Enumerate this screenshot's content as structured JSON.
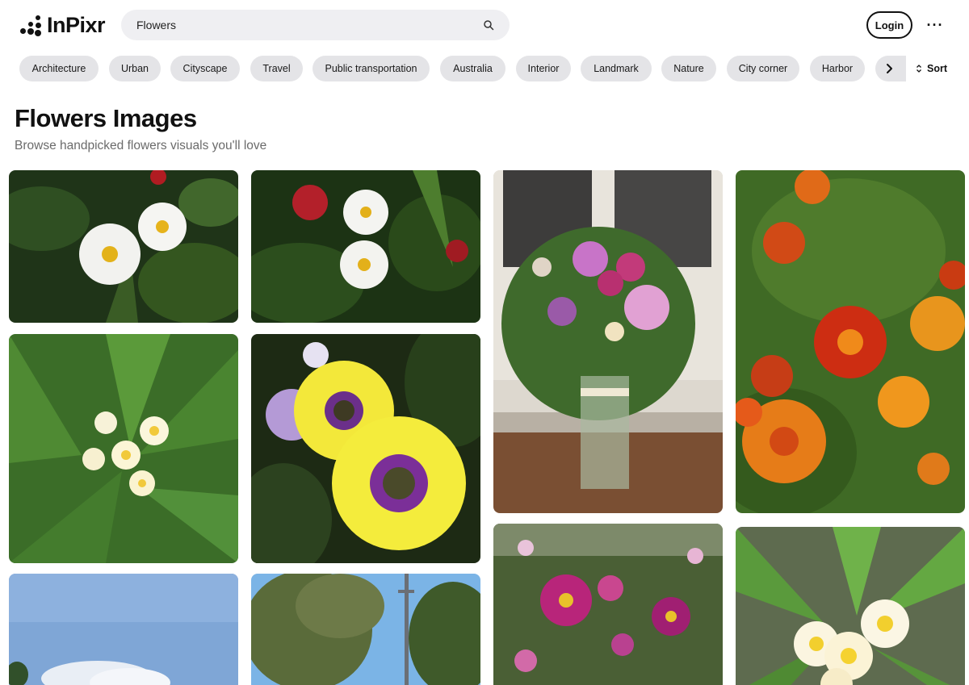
{
  "brand": {
    "name": "InPixr"
  },
  "search": {
    "value": "Flowers"
  },
  "header": {
    "login_label": "Login",
    "more_label": "···"
  },
  "categories": [
    "Architecture",
    "Urban",
    "Cityscape",
    "Travel",
    "Public transportation",
    "Australia",
    "Interior",
    "Landmark",
    "Nature",
    "City corner",
    "Harbor"
  ],
  "sort": {
    "label": "Sort"
  },
  "page": {
    "title": "Flowers Images",
    "subtitle": "Browse handpicked flowers visuals you'll love"
  },
  "gallery": [
    {
      "subject": "white daisies with red flower on dark foliage"
    },
    {
      "subject": "white daisies and red roses in garden"
    },
    {
      "subject": "bouquet of pink flowers in glass vase"
    },
    {
      "subject": "orange and red marigolds"
    },
    {
      "subject": "white and yellow frangipani with green leaves"
    },
    {
      "subject": "yellow and purple osteospermum daisies"
    },
    {
      "subject": "pink and purple dahlias"
    },
    {
      "subject": "sky with clouds and treetop"
    },
    {
      "subject": "trees and lamp post against blue sky"
    },
    {
      "subject": "frangipani flowers among long green leaves"
    }
  ],
  "colors": {
    "chip_bg": "#e4e4e7",
    "search_bg": "#efeff2",
    "text": "#111111",
    "subtitle": "#6b6b6b"
  }
}
